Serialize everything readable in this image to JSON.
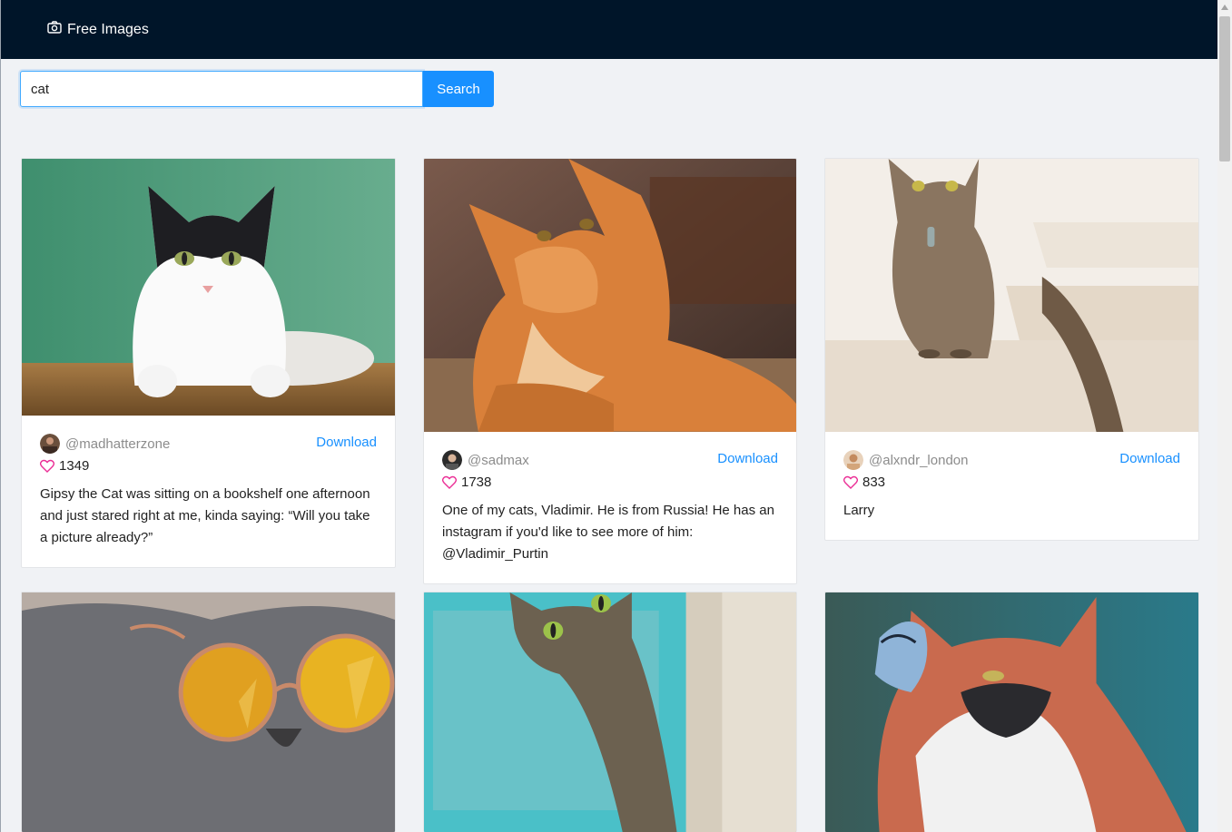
{
  "header": {
    "brand": "Free Images",
    "brand_icon": "camera-icon"
  },
  "search": {
    "value": "cat",
    "button_label": "Search"
  },
  "cards": [
    {
      "username": "@madhatterzone",
      "download_label": "Download",
      "likes": "1349",
      "description": "Gipsy the Cat was sitting on a bookshelf one afternoon and just stared right at me, kinda saying: “Will you take a picture already?”"
    },
    {
      "username": "@sadmax",
      "download_label": "Download",
      "likes": "1738",
      "description": "One of my cats, Vladimir. He is from Russia! He has an instagram if you'd like to see more of him: @Vladimir_Purtin"
    },
    {
      "username": "@alxndr_london",
      "download_label": "Download",
      "likes": "833",
      "description": "Larry"
    },
    {
      "username": "",
      "download_label": "",
      "likes": "",
      "description": ""
    },
    {
      "username": "",
      "download_label": "",
      "likes": "",
      "description": ""
    },
    {
      "username": "",
      "download_label": "",
      "likes": "",
      "description": ""
    }
  ],
  "colors": {
    "header_bg": "#001529",
    "accent": "#1890ff",
    "heart": "#eb2f96",
    "page_bg": "#f0f2f5"
  }
}
